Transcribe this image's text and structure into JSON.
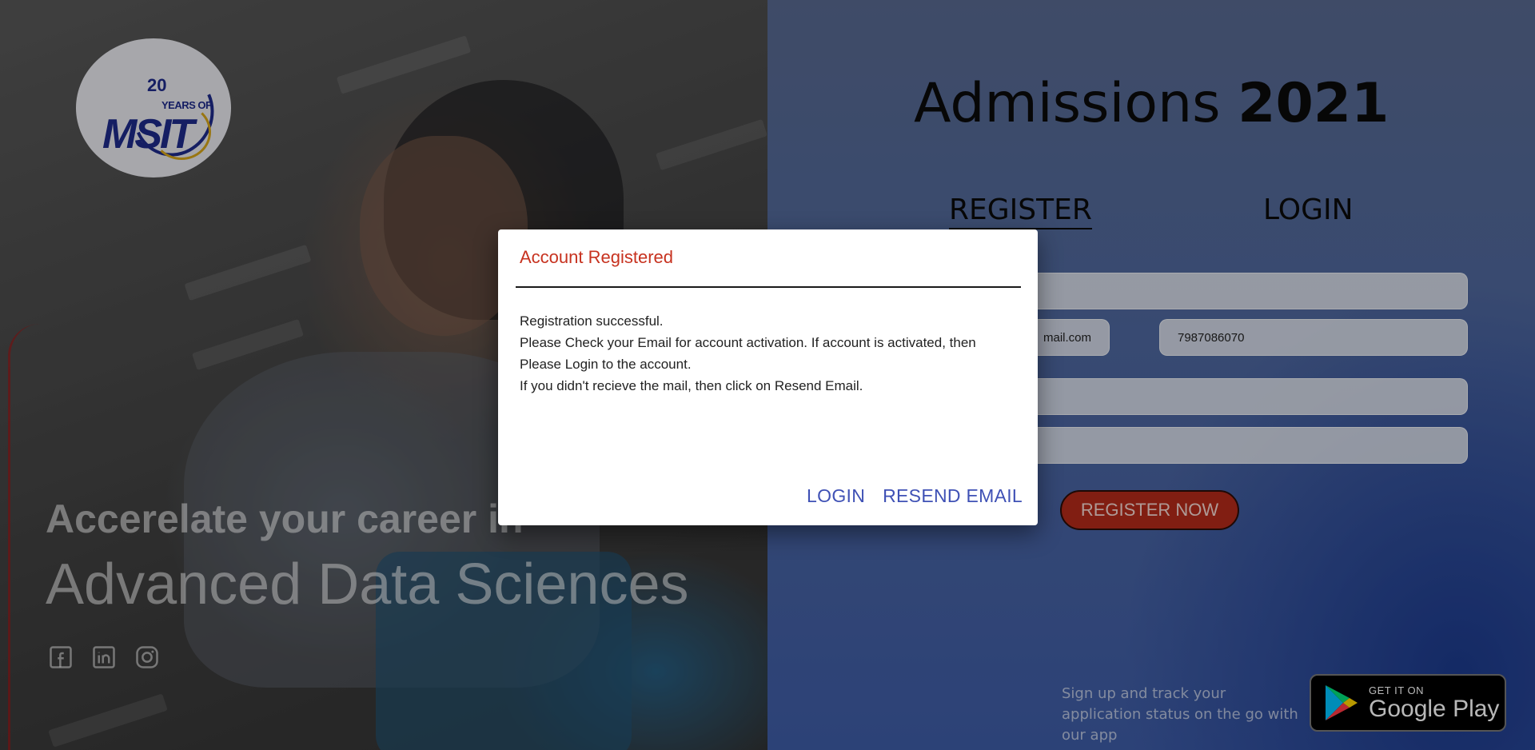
{
  "hero": {
    "logo": {
      "years_number": "20",
      "years_text": "YEARS OF",
      "brand": "MSIT"
    },
    "tagline_line1": "Accerelate your career in",
    "tagline_line2": "Advanced Data Sciences",
    "socials": [
      "facebook-icon",
      "linkedin-icon",
      "instagram-icon"
    ]
  },
  "panel": {
    "title_text": "Admissions ",
    "title_year": "2021",
    "tabs": {
      "register": "REGISTER",
      "login": "LOGIN"
    },
    "fields": {
      "email_value": "mail.com",
      "phone_value": "7987086070"
    },
    "register_button": "REGISTER NOW",
    "app_promo": "Sign up and track your application status on the go with our app",
    "google_play": {
      "small": "GET IT ON",
      "big": "Google Play"
    }
  },
  "modal": {
    "title": "Account Registered",
    "lines": [
      "Registration successful.",
      "Please Check your Email for account activation. If account is activated, then Please Login to the account.",
      "If you didn't recieve the mail, then click on Resend Email."
    ],
    "login_button": "LOGIN",
    "resend_button": "RESEND EMAIL"
  },
  "colors": {
    "modal_title": "#c7321f",
    "modal_action": "#3f51b5",
    "register_button": "#b32a1a",
    "panel_blue": "#3e5ca6"
  }
}
